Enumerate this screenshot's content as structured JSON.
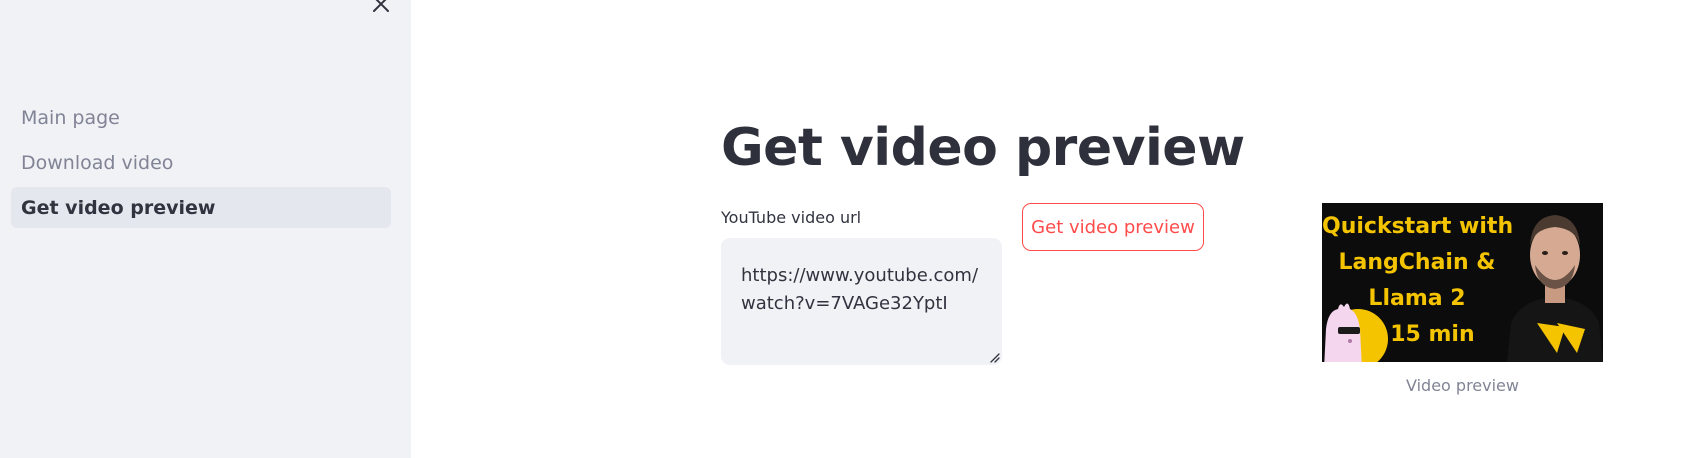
{
  "sidebar": {
    "nav_items": [
      {
        "label": "Main page",
        "active": false
      },
      {
        "label": "Download video",
        "active": false
      },
      {
        "label": "Get video preview",
        "active": true
      }
    ],
    "close_icon": "close-icon"
  },
  "main": {
    "title": "Get video preview",
    "url_field": {
      "label": "YouTube video url",
      "value": "https://www.youtube.com/watch?v=7VAGe32YptI"
    },
    "action_button_label": "Get video preview",
    "preview": {
      "thumbnail_lines": [
        "Quickstart with",
        "LangChain &",
        "Llama 2",
        "in 15 min"
      ],
      "caption": "Video preview"
    }
  },
  "colors": {
    "sidebar_bg": "#f0f2f6",
    "accent": "#ff4b4b",
    "thumbnail_text": "#f5c400",
    "text": "#31333f",
    "muted": "#808495"
  }
}
